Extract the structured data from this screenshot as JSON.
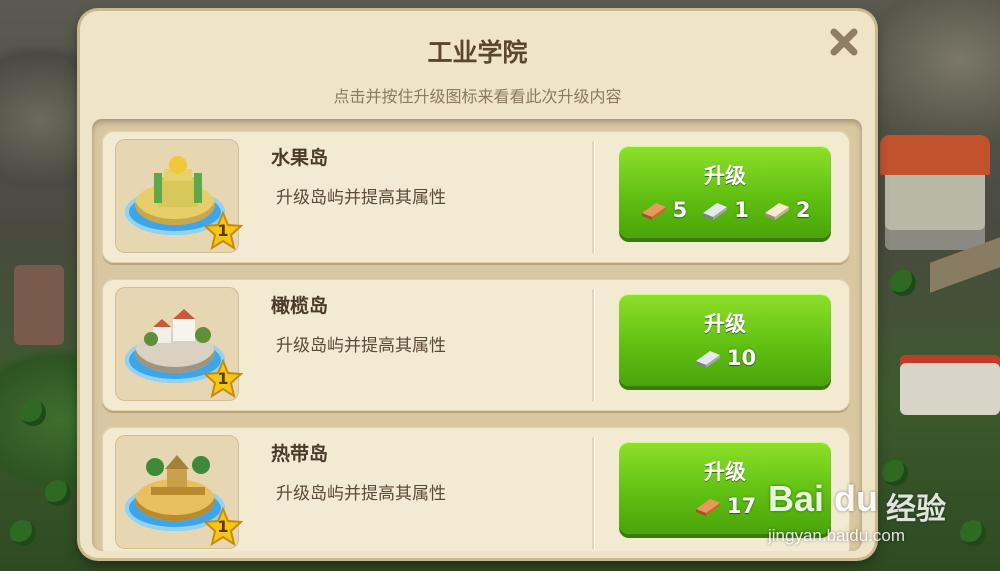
{
  "dialog": {
    "title": "工业学院",
    "close_icon": "close-icon",
    "subtitle": "点击并按住升级图标来看看此次升级内容"
  },
  "islands": [
    {
      "name": "水果岛",
      "description": "升级岛屿并提高其属性",
      "level": "1",
      "upgrade_label": "升级",
      "costs": [
        {
          "icon": "copper-ingot-icon",
          "amount": "5"
        },
        {
          "icon": "silver-ingot-icon",
          "amount": "1"
        },
        {
          "icon": "platinum-ingot-icon",
          "amount": "2"
        }
      ]
    },
    {
      "name": "橄榄岛",
      "description": "升级岛屿并提高其属性",
      "level": "1",
      "upgrade_label": "升级",
      "costs": [
        {
          "icon": "silver-ingot-icon",
          "amount": "10"
        }
      ]
    },
    {
      "name": "热带岛",
      "description": "升级岛屿并提高其属性",
      "level": "1",
      "upgrade_label": "升级",
      "costs": [
        {
          "icon": "copper-ingot-icon",
          "amount": "17"
        }
      ]
    }
  ],
  "watermark": {
    "logo": "Bai du",
    "brand": "经验",
    "url": "jingyan.baidu.com"
  },
  "colors": {
    "button_green": "#61c012",
    "panel_bg": "#efe4c7",
    "copper": "#d27a3a",
    "silver": "#b8bcc0",
    "platinum": "#e2d7b6"
  }
}
